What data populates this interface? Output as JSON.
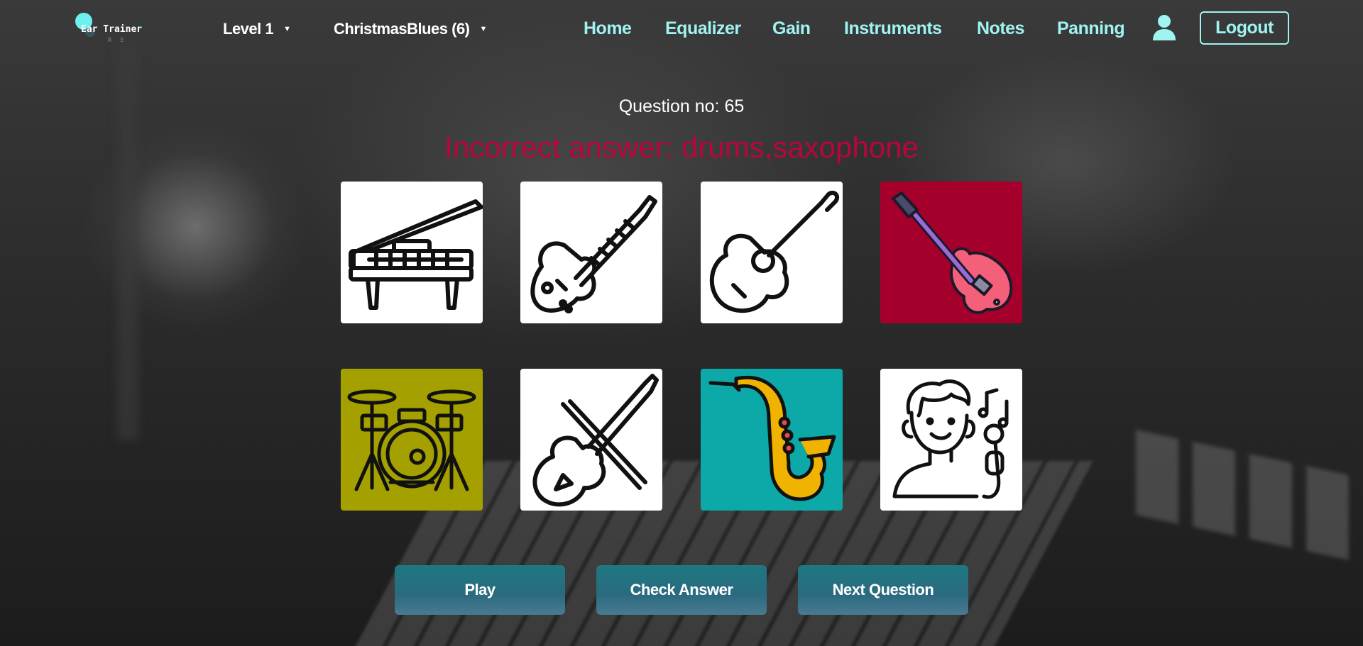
{
  "app": {
    "logo_text": "Ear Trainer",
    "logo_sub": "R E"
  },
  "header": {
    "level_dropdown": "Level 1",
    "song_dropdown": "ChristmasBlues (6)",
    "nav": [
      "Home",
      "Equalizer",
      "Gain",
      "Instruments",
      "Notes",
      "Panning"
    ],
    "logout_label": "Logout"
  },
  "quiz": {
    "question_label": "Question no: 65",
    "result_message": "Incorrect answer: drums,saxophone",
    "result_color": "#b8063a",
    "tiles": [
      {
        "icon": "piano-icon",
        "state": "unselected",
        "bg": "#ffffff"
      },
      {
        "icon": "electric-guitar-icon",
        "state": "unselected",
        "bg": "#ffffff"
      },
      {
        "icon": "acoustic-guitar-icon",
        "state": "unselected",
        "bg": "#ffffff"
      },
      {
        "icon": "bass-guitar-icon",
        "state": "selected-incorrect",
        "bg": "#a5002c"
      },
      {
        "icon": "drums-icon",
        "state": "correct-missed",
        "bg": "#a3a000"
      },
      {
        "icon": "violin-icon",
        "state": "unselected",
        "bg": "#ffffff"
      },
      {
        "icon": "saxophone-icon",
        "state": "correct",
        "bg": "#0da8a8"
      },
      {
        "icon": "singer-icon",
        "state": "unselected",
        "bg": "#ffffff"
      }
    ]
  },
  "buttons": {
    "play": "Play",
    "check": "Check Answer",
    "next": "Next Question"
  },
  "colors": {
    "accent": "#9ff4f2",
    "button": "#1e7880"
  }
}
